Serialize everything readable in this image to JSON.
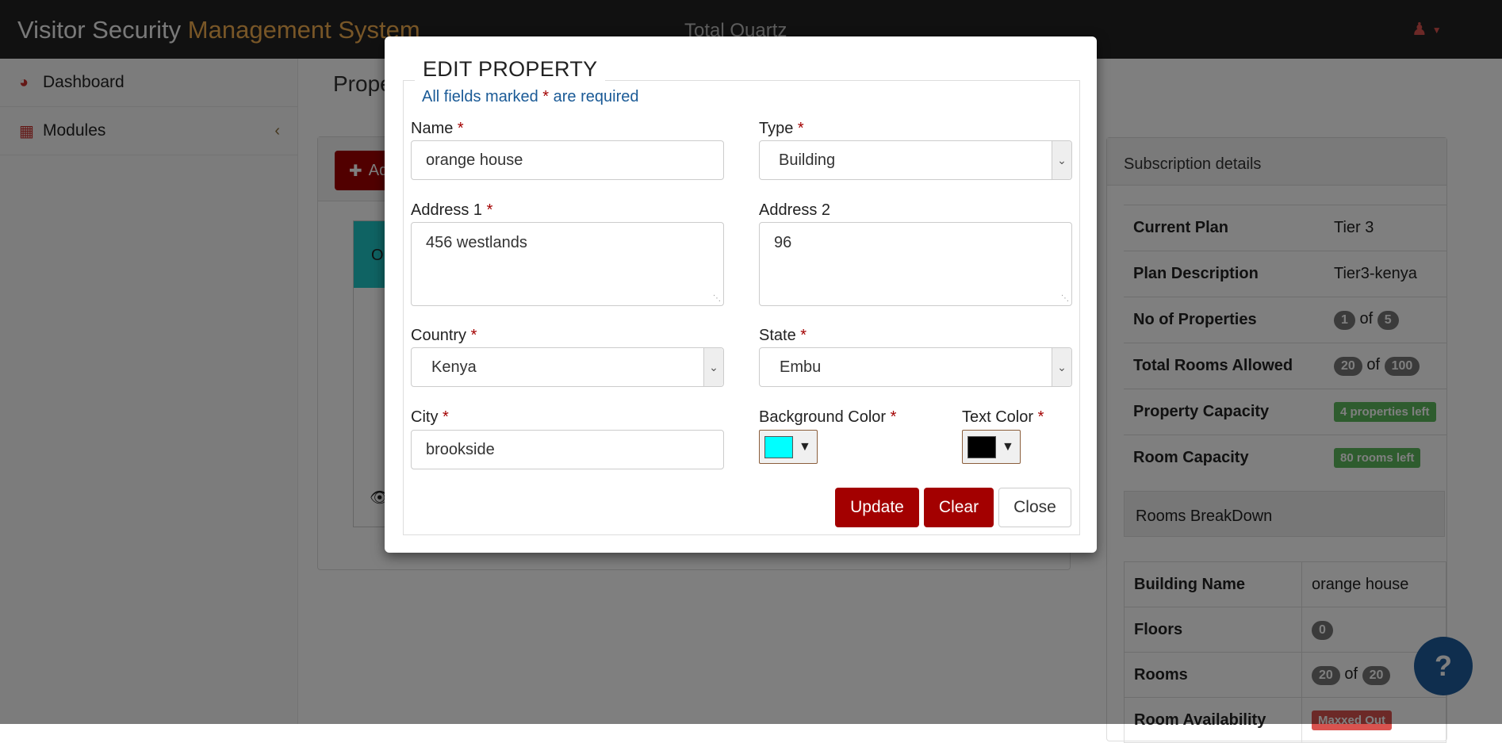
{
  "navbar": {
    "brand_prefix": "Visitor Security",
    "brand_accent": "Management System",
    "center_title": "Total Quartz"
  },
  "sidebar": {
    "items": [
      {
        "label": "Dashboard",
        "icon": "dashboard-icon"
      },
      {
        "label": "Modules",
        "icon": "grid-icon"
      }
    ]
  },
  "main": {
    "page_title": "Prope",
    "add_button": "Ad",
    "card_title": "O"
  },
  "subscription": {
    "title": "Subscription details",
    "current_plan_label": "Current Plan",
    "current_plan": "Tier 3",
    "plan_description_label": "Plan Description",
    "plan_description": "Tier3-kenya",
    "no_of_properties_label": "No of Properties",
    "properties_used": "1",
    "properties_total": "5",
    "of": "of",
    "total_rooms_label": "Total Rooms Allowed",
    "rooms_used": "20",
    "rooms_total": "100",
    "property_capacity_label": "Property Capacity",
    "property_capacity": "4 properties left",
    "room_capacity_label": "Room Capacity",
    "room_capacity": "80 rooms left"
  },
  "rooms_breakdown": {
    "title": "Rooms BreakDown",
    "building_name_label": "Building Name",
    "building_name": "orange house",
    "floors_label": "Floors",
    "floors": "0",
    "rooms_label": "Rooms",
    "rooms_used": "20",
    "rooms_total": "20",
    "availability_label": "Room Availability",
    "availability": "Maxxed Out"
  },
  "help_button": "?",
  "modal": {
    "title": "EDIT PROPERTY",
    "required_note_prefix": "All fields marked",
    "required_note_suffix": "are required",
    "required_mark": "*",
    "name_label": "Name",
    "name_value": "orange house",
    "type_label": "Type",
    "type_value": "Building",
    "address1_label": "Address 1",
    "address1_value": "456 westlands",
    "address2_label": "Address 2",
    "address2_value": "96",
    "country_label": "Country",
    "country_value": "Kenya",
    "state_label": "State",
    "state_value": "Embu",
    "city_label": "City",
    "city_value": "brookside",
    "bg_color_label": "Background Color",
    "bg_color": "#00ffff",
    "text_color_label": "Text Color",
    "text_color": "#000000",
    "update_button": "Update",
    "clear_button": "Clear",
    "close_button": "Close"
  },
  "colors": {
    "brand_red": "#a30000",
    "accent_orange": "#f0ad4e",
    "card_cyan": "#1ec6c6",
    "success": "#5cb85c",
    "danger": "#d9534f"
  }
}
